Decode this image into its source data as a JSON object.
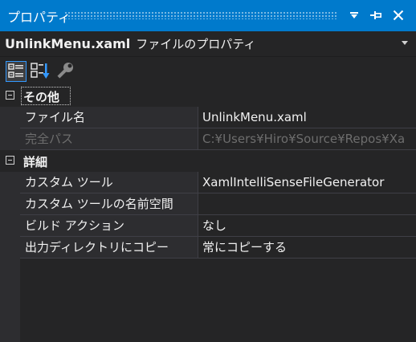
{
  "window": {
    "title": "プロパティ"
  },
  "object": {
    "name": "UnlinkMenu.xaml",
    "type": "ファイルのプロパティ"
  },
  "toolbar": {
    "icons": [
      "categorized-icon",
      "alphabetical-icon",
      "property-pages-icon"
    ]
  },
  "categories": [
    {
      "name": "その他",
      "properties": [
        {
          "name": "ファイル名",
          "value": "UnlinkMenu.xaml"
        },
        {
          "name": "完全パス",
          "value": "C:¥Users¥Hiro¥Source¥Repos¥Xa"
        }
      ]
    },
    {
      "name": "詳細",
      "properties": [
        {
          "name": "カスタム ツール",
          "value": "XamlIntelliSenseFileGenerator"
        },
        {
          "name": "カスタム ツールの名前空間",
          "value": ""
        },
        {
          "name": "ビルド アクション",
          "value": "なし"
        },
        {
          "name": "出力ディレクトリにコピー",
          "value": "常にコピーする"
        }
      ]
    }
  ],
  "colors": {
    "accent": "#007acc",
    "background": "#252526",
    "grid_line": "#3f3f46",
    "disabled_text": "#6d6d6d"
  }
}
